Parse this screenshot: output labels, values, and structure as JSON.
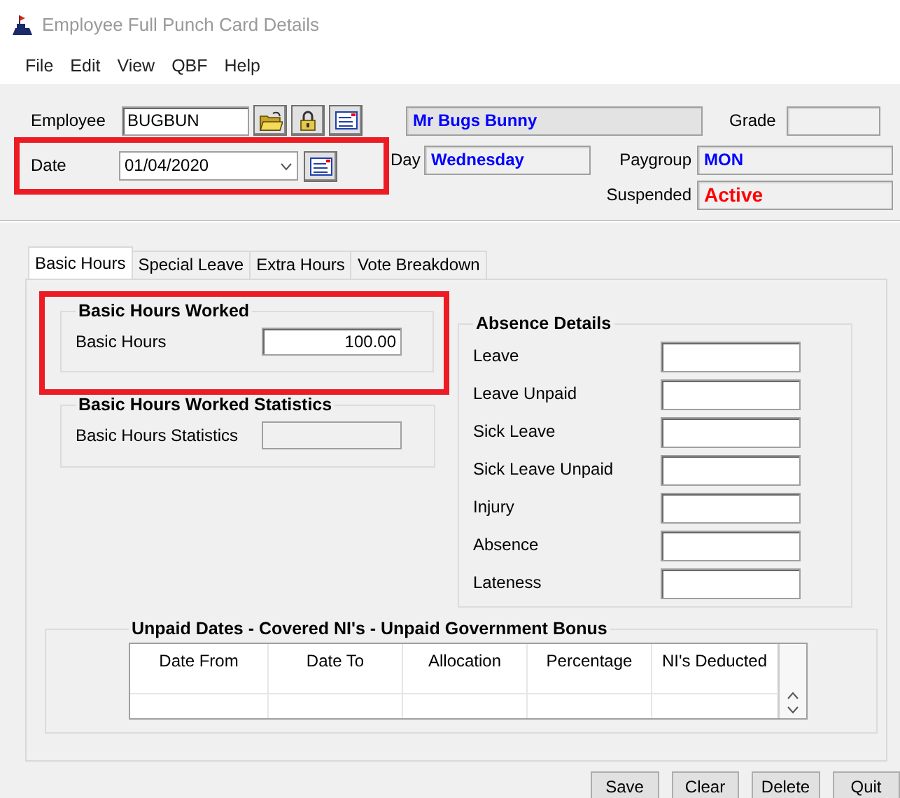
{
  "window": {
    "title": "Employee Full Punch Card Details"
  },
  "menu": [
    "File",
    "Edit",
    "View",
    "QBF",
    "Help"
  ],
  "header": {
    "employee": {
      "label": "Employee",
      "value": "BUGBUN"
    },
    "name": "Mr Bugs Bunny",
    "grade": {
      "label": "Grade"
    },
    "date": {
      "label": "Date",
      "value": "01/04/2020",
      "highlighted": true
    },
    "day": {
      "label": "Day",
      "value": "Wednesday"
    },
    "paygroup": {
      "label": "Paygroup",
      "value": "MON"
    },
    "suspended": {
      "label": "Suspended",
      "value": "Active"
    }
  },
  "tabs": [
    {
      "label": "Basic Hours",
      "selected": true
    },
    {
      "label": "Special Leave",
      "selected": false
    },
    {
      "label": "Extra Hours",
      "selected": false
    },
    {
      "label": "Vote Breakdown",
      "selected": false
    }
  ],
  "basic_hours": {
    "title": "Basic Hours Worked",
    "label": "Basic Hours",
    "value": "100.00",
    "highlighted": true
  },
  "statistics": {
    "title": "Basic Hours Worked Statistics",
    "label": "Basic Hours Statistics",
    "disabled": true
  },
  "absence": {
    "title": "Absence Details",
    "fields": [
      "Leave",
      "Leave Unpaid",
      "Sick Leave",
      "Sick Leave Unpaid",
      "Injury",
      "Absence",
      "Lateness"
    ]
  },
  "unpaid": {
    "title": "Unpaid Dates - Covered NI's - Unpaid Government Bonus",
    "columns": [
      "Date From",
      "Date To",
      "Allocation",
      "Percentage",
      "NI's Deducted"
    ]
  },
  "buttons": [
    "Save",
    "Clear",
    "Delete",
    "Quit"
  ]
}
